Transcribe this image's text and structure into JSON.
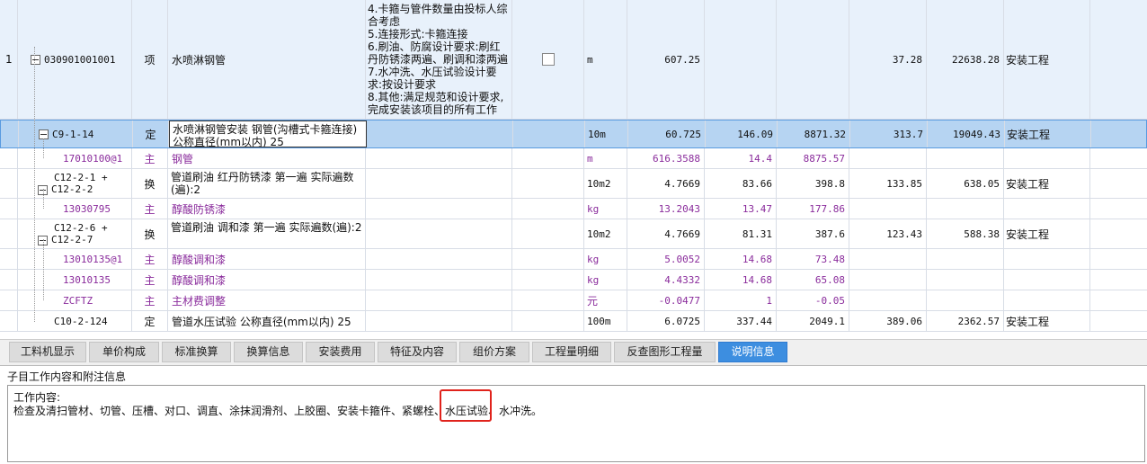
{
  "rows": [
    {
      "idx": "1",
      "code": "030901001001",
      "type": "项",
      "name": "水喷淋钢管",
      "feature_lines": [
        "4.卡箍与管件数量由投标人综",
        "合考虑",
        "5.连接形式:卡箍连接",
        "6.刷油、防腐设计要求:刷红",
        "丹防锈漆两遍、刷调和漆两遍",
        "7.水冲洗、水压试验设计要",
        "求:按设计要求",
        "8.其他:满足规范和设计要求,",
        "完成安装该项目的所有工作"
      ],
      "unit": "m",
      "qty": "607.25",
      "price": "",
      "amount": "",
      "fee": "37.28",
      "total": "22638.28",
      "category": "安装工程"
    },
    {
      "idx": "",
      "code": "C9-1-14",
      "type": "定",
      "name": "水喷淋钢管安装 钢管(沟槽式卡箍连接) 公称直径(mm以内) 25",
      "unit": "10m",
      "qty": "60.725",
      "price": "146.09",
      "amount": "8871.32",
      "fee": "313.7",
      "total": "19049.43",
      "category": "安装工程"
    },
    {
      "idx": "",
      "code": "17010100@1",
      "type": "主",
      "name": "钢管",
      "unit": "m",
      "qty": "616.3588",
      "price": "14.4",
      "amount": "8875.57",
      "fee": "",
      "total": "",
      "category": ""
    },
    {
      "idx": "",
      "code_lines": [
        "C12-2-1 +",
        "C12-2-2"
      ],
      "type": "换",
      "name": "管道刷油 红丹防锈漆 第一遍  实际遍数(遍):2",
      "unit": "10m2",
      "qty": "4.7669",
      "price": "83.66",
      "amount": "398.8",
      "fee": "133.85",
      "total": "638.05",
      "category": "安装工程"
    },
    {
      "idx": "",
      "code": "13030795",
      "type": "主",
      "name": "醇酸防锈漆",
      "unit": "kg",
      "qty": "13.2043",
      "price": "13.47",
      "amount": "177.86",
      "fee": "",
      "total": "",
      "category": ""
    },
    {
      "idx": "",
      "code_lines": [
        "C12-2-6 +",
        "C12-2-7"
      ],
      "type": "换",
      "name": "管道刷油 调和漆 第一遍  实际遍数(遍):2",
      "unit": "10m2",
      "qty": "4.7669",
      "price": "81.31",
      "amount": "387.6",
      "fee": "123.43",
      "total": "588.38",
      "category": "安装工程"
    },
    {
      "idx": "",
      "code": "13010135@1",
      "type": "主",
      "name": "醇酸调和漆",
      "unit": "kg",
      "qty": "5.0052",
      "price": "14.68",
      "amount": "73.48",
      "fee": "",
      "total": "",
      "category": ""
    },
    {
      "idx": "",
      "code": "13010135",
      "type": "主",
      "name": "醇酸调和漆",
      "unit": "kg",
      "qty": "4.4332",
      "price": "14.68",
      "amount": "65.08",
      "fee": "",
      "total": "",
      "category": ""
    },
    {
      "idx": "",
      "code": "ZCFTZ",
      "type": "主",
      "name": "主材费调整",
      "unit": "元",
      "qty": "-0.0477",
      "price": "1",
      "amount": "-0.05",
      "fee": "",
      "total": "",
      "category": ""
    },
    {
      "idx": "",
      "code": "C10-2-124",
      "type": "定",
      "name": "管道水压试验 公称直径(mm以内) 25",
      "unit": "100m",
      "qty": "6.0725",
      "price": "337.44",
      "amount": "2049.1",
      "fee": "389.06",
      "total": "2362.57",
      "category": "安装工程"
    }
  ],
  "tabs": [
    "工料机显示",
    "单价构成",
    "标准换算",
    "换算信息",
    "安装费用",
    "特征及内容",
    "组价方案",
    "工程量明细",
    "反查图形工程量",
    "说明信息"
  ],
  "active_tab": "说明信息",
  "panel": {
    "title": "子目工作内容和附注信息",
    "heading": "工作内容:",
    "text_before": "检查及清扫管材、切管、压槽、对口、调直、涂抹润滑剂、上胶圈、安装卡箍件、紧螺栓、",
    "text_highlight": "水压试验",
    "text_after": "、水冲洗。"
  },
  "colors": {
    "highlight_box": "#e0231c",
    "active_tab": "#3d8ee0",
    "selected_row": "#b6d4f2",
    "material_text": "#8a2c9c"
  }
}
